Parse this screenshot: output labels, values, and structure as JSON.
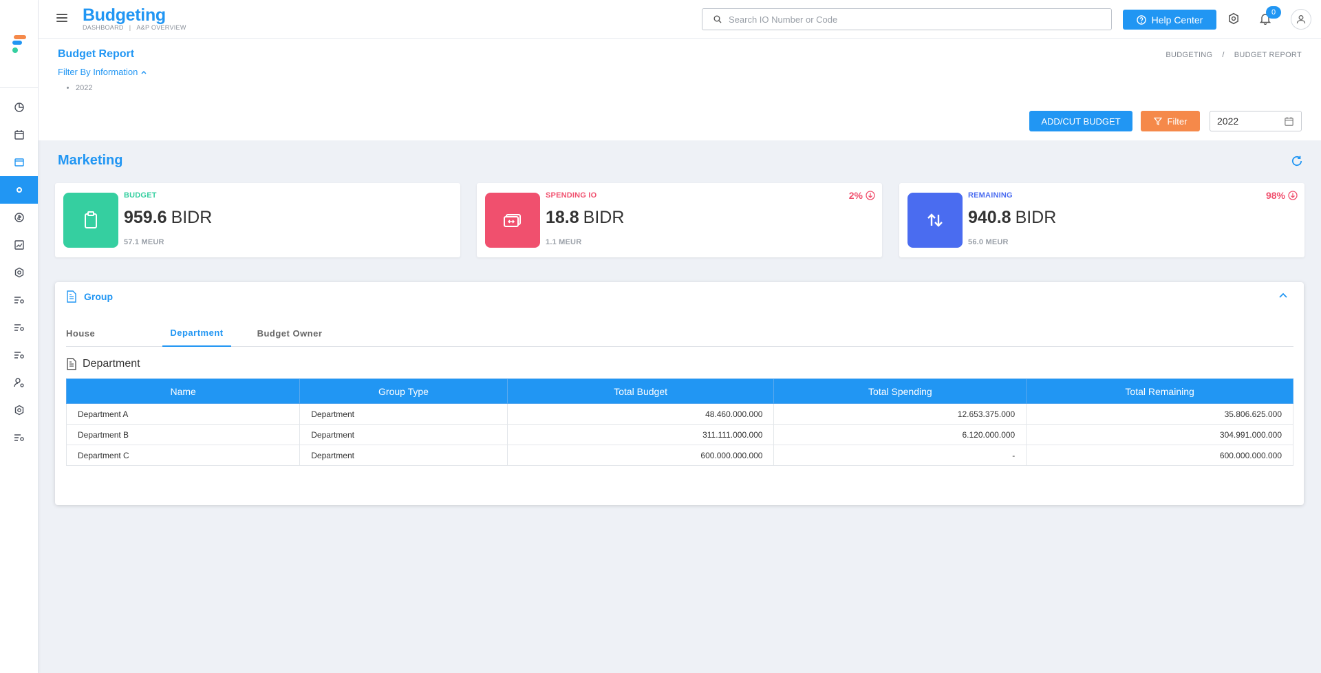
{
  "app": {
    "title": "Budgeting",
    "breadcrumb_top": [
      "DASHBOARD",
      "A&P OVERVIEW"
    ]
  },
  "search": {
    "placeholder": "Search IO Number or Code"
  },
  "header_actions": {
    "help_label": "Help Center",
    "notification_count": "0"
  },
  "page": {
    "title": "Budget Report",
    "filter_label": "Filter By Information",
    "filter_values": [
      "2022"
    ],
    "breadcrumb": [
      "BUDGETING",
      "/",
      "BUDGET REPORT"
    ],
    "add_cut_label": "ADD/CUT BUDGET",
    "filter_button_label": "Filter",
    "year_value": "2022"
  },
  "section": {
    "title": "Marketing"
  },
  "cards": [
    {
      "label": "BUDGET",
      "value": "959.6",
      "unit": "BIDR",
      "sub": "57.1 MEUR",
      "pct": "",
      "color": "#35cfa0"
    },
    {
      "label": "SPENDING IO",
      "value": "18.8",
      "unit": "BIDR",
      "sub": "1.1 MEUR",
      "pct": "2%",
      "color": "#f0506e"
    },
    {
      "label": "REMAINING",
      "value": "940.8",
      "unit": "BIDR",
      "sub": "56.0 MEUR",
      "pct": "98%",
      "color": "#4a6cf0"
    }
  ],
  "group": {
    "title": "Group",
    "tabs": [
      "House",
      "Department",
      "Budget Owner"
    ],
    "active_tab": "Department",
    "subtitle": "Department",
    "columns": [
      "Name",
      "Group Type",
      "Total Budget",
      "Total Spending",
      "Total Remaining"
    ],
    "rows": [
      [
        "Department A",
        "Department",
        "48.460.000.000",
        "12.653.375.000",
        "35.806.625.000"
      ],
      [
        "Department B",
        "Department",
        "311.111.000.000",
        "6.120.000.000",
        "304.991.000.000"
      ],
      [
        "Department C",
        "Department",
        "600.000.000.000",
        "-",
        "600.000.000.000"
      ]
    ]
  },
  "colors": {
    "accent": "#2196f3",
    "filter_orange": "#f5894a",
    "budget_green": "#35cfa0",
    "spending_red": "#f0506e",
    "remaining_blue": "#4a6cf0"
  },
  "sidebar_icons": [
    "pie-chart-icon",
    "calendar-icon",
    "window-icon",
    "settings-dot-icon",
    "coin-icon",
    "image-chart-icon",
    "gear-icon",
    "filter-settings-icon",
    "filter-settings-icon",
    "filter-settings-icon",
    "user-settings-icon",
    "gear-icon",
    "filter-settings-icon"
  ]
}
